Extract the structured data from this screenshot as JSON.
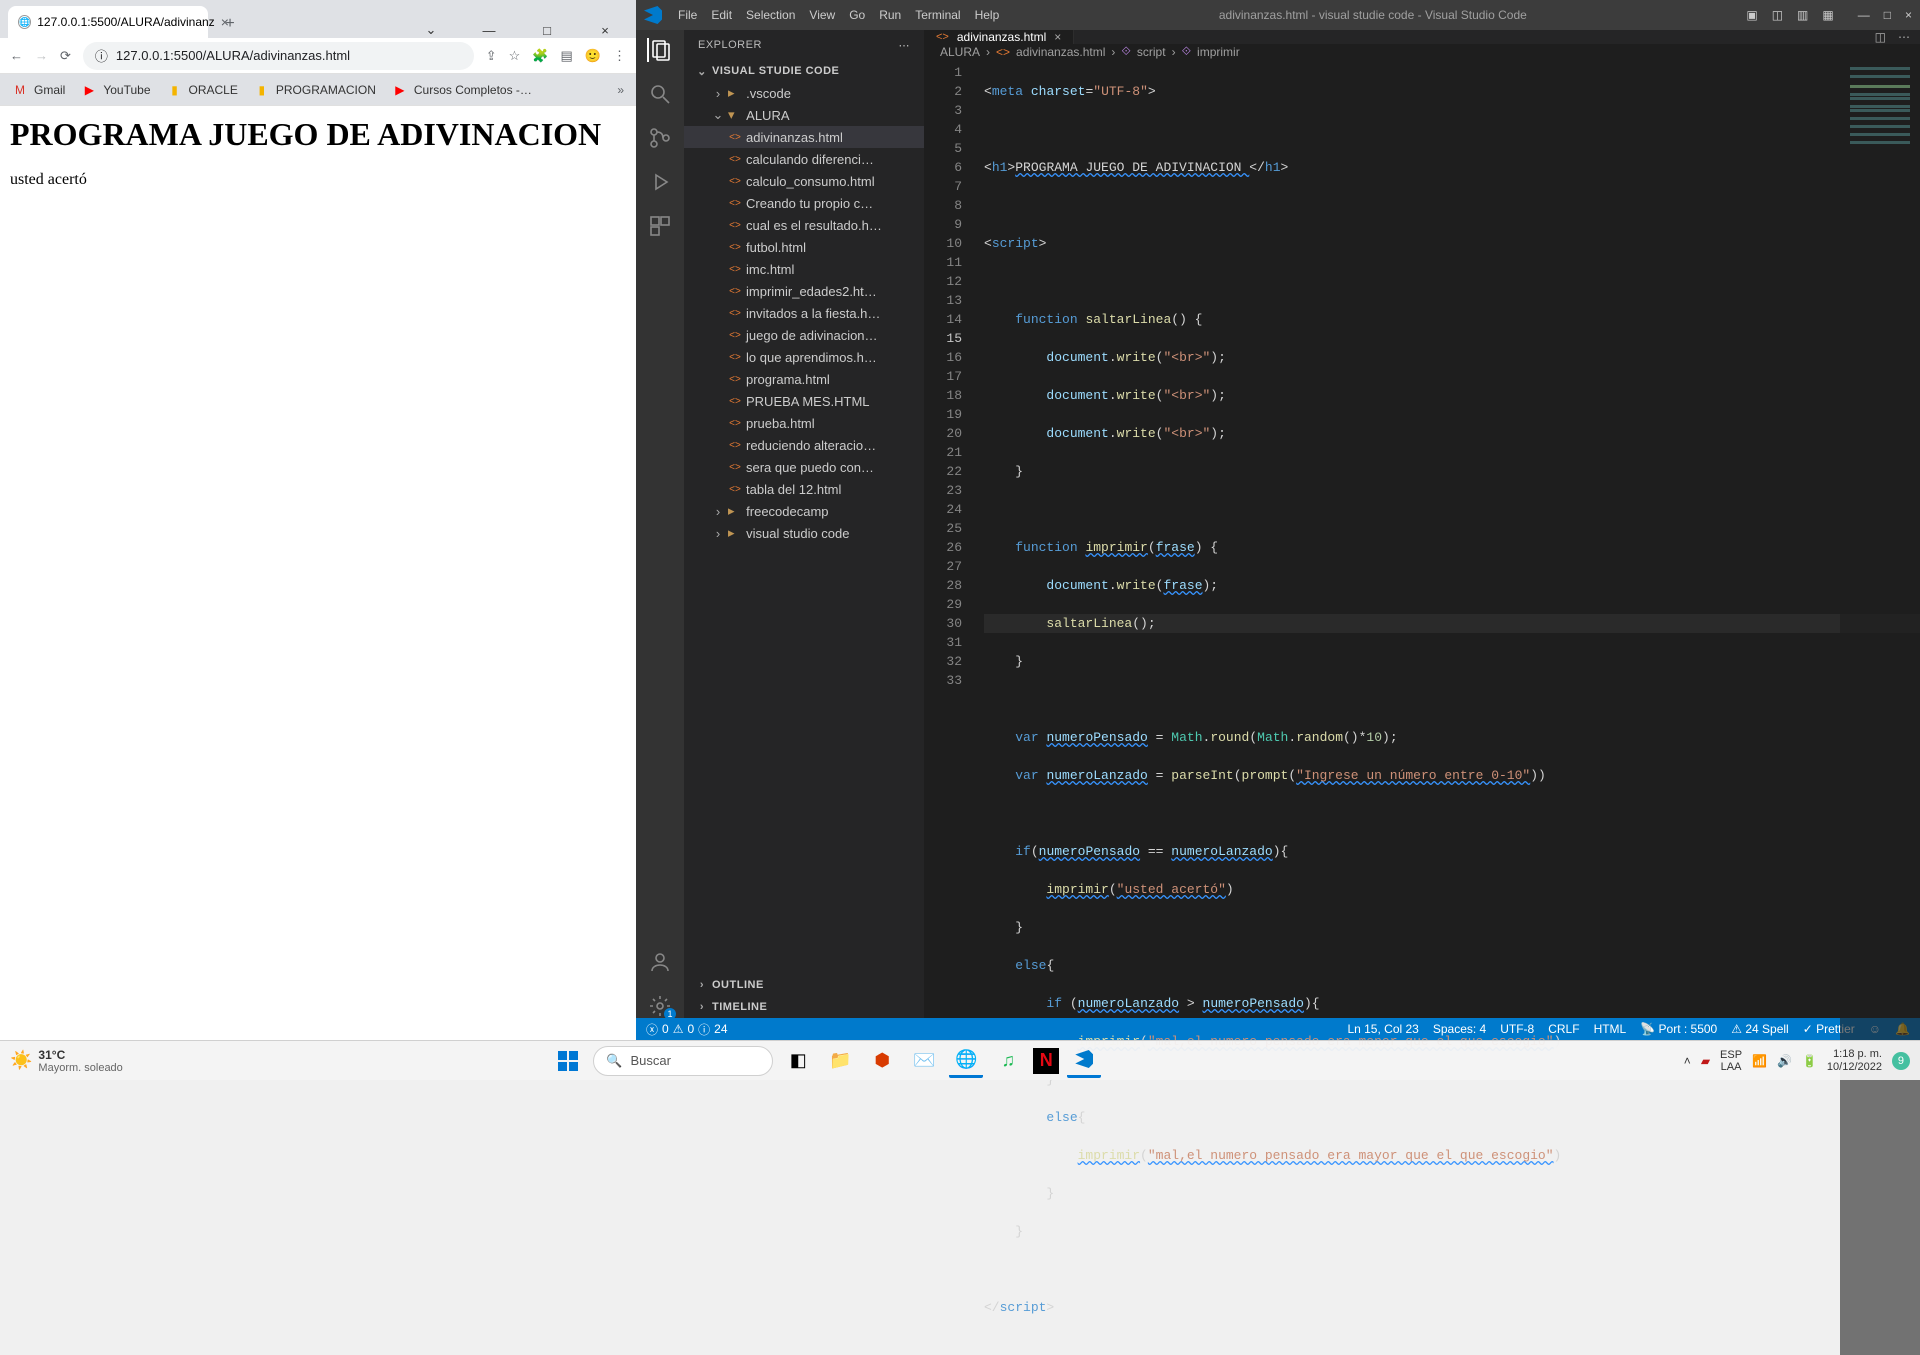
{
  "browser": {
    "tab_title": "127.0.0.1:5500/ALURA/adivinanz",
    "address": "127.0.0.1:5500/ALURA/adivinanzas.html",
    "bookmarks": {
      "gmail": "Gmail",
      "youtube": "YouTube",
      "oracle": "ORACLE",
      "programacion": "PROGRAMACION",
      "cursos": "Cursos Completos -…"
    },
    "page": {
      "h1": "PROGRAMA JUEGO DE ADIVINACION",
      "body": "usted acertó"
    }
  },
  "vscode": {
    "title": "adivinanzas.html - visual studie code - Visual Studio Code",
    "menu": [
      "File",
      "Edit",
      "Selection",
      "View",
      "Go",
      "Run",
      "Terminal",
      "Help"
    ],
    "explorer": {
      "header": "EXPLORER",
      "workspace": "VISUAL STUDIE CODE",
      "folders": {
        "vscode": ".vscode",
        "alura": "ALURA",
        "freecodecamp": "freecodecamp",
        "visualstudio": "visual studio code"
      },
      "files": [
        "adivinanzas.html",
        "calculando diferenci…",
        "calculo_consumo.html",
        "Creando tu propio c…",
        "cual es el resultado.h…",
        "futbol.html",
        "imc.html",
        "imprimir_edades2.ht…",
        "invitados a la fiesta.h…",
        "juego de adivinacion…",
        "lo que aprendimos.h…",
        "programa.html",
        "PRUEBA MES.HTML",
        "prueba.html",
        "reduciendo alteracio…",
        "sera que puedo con…",
        "tabla del 12.html"
      ],
      "outline": "OUTLINE",
      "timeline": "TIMELINE"
    },
    "tab": {
      "name": "adivinanzas.html"
    },
    "breadcrumbs": {
      "a": "ALURA",
      "b": "adivinanzas.html",
      "c": "script",
      "d": "imprimir"
    },
    "status": {
      "errors": "0",
      "warnings": "0",
      "info": "24",
      "ln_col": "Ln 15, Col 23",
      "spaces": "Spaces: 4",
      "encoding": "UTF-8",
      "eol": "CRLF",
      "lang": "HTML",
      "port": "Port : 5500",
      "spell": "24 Spell",
      "prettier": "Prettier"
    },
    "code": {
      "meta_charset": "UTF-8",
      "h1_text": "PROGRAMA JUEGO DE ADIVINACION ",
      "fn_saltar": "saltarLinea",
      "fn_imprimir": "imprimir",
      "param_frase": "frase",
      "doc_write": "document",
      "write": "write",
      "br": "\"<br>\"",
      "var_pensado": "numeroPensado",
      "math_expr_a": "Math",
      "math_expr_b": "round",
      "math_expr_c": "random",
      "times10": "10",
      "var_lanzado": "numeroLanzado",
      "parseint": "parseInt",
      "prompt": "prompt",
      "prompt_str": "\"Ingrese un número entre 0-10\"",
      "acerto": "\"usted acertó\"",
      "msg_menor": "\"mal,el numero pensado era menor que el que escogio\"",
      "msg_mayor": "\"mal,el numero pensado era mayor que el que escogio\""
    }
  },
  "taskbar": {
    "weather_temp": "31°C",
    "weather_desc": "Mayorm. soleado",
    "search": "Buscar",
    "lang_top": "ESP",
    "lang_bot": "LAA",
    "time": "1:18 p. m.",
    "date": "10/12/2022",
    "notif": "9"
  }
}
